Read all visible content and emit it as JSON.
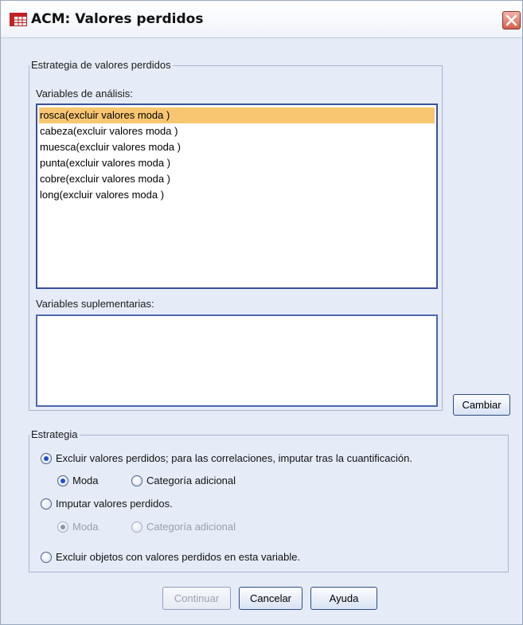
{
  "window": {
    "title": "ACM: Valores perdidos"
  },
  "strategy_group": {
    "legend": "Estrategia de valores perdidos",
    "analysis_label": "Variables de análisis:",
    "analysis_items": [
      "rosca(excluir valores moda )",
      "cabeza(excluir valores moda )",
      "muesca(excluir valores moda )",
      "punta(excluir valores moda )",
      "cobre(excluir valores moda )",
      "long(excluir valores moda )"
    ],
    "supplementary_label": "Variables suplementarias:",
    "change_button": "Cambiar"
  },
  "estrategia_group": {
    "legend": "Estrategia",
    "option_exclude": "Excluir valores perdidos; para las correlaciones, imputar tras la cuantificación.",
    "option_exclude_selected": true,
    "exclude_mode": "Moda",
    "exclude_additional": "Categoría adicional",
    "option_impute": "Imputar valores perdidos.",
    "impute_mode": "Moda",
    "impute_additional": "Categoría adicional",
    "option_exclude_objects": "Excluir objetos con valores perdidos en esta variable."
  },
  "buttons": {
    "continue": "Continuar",
    "cancel": "Cancelar",
    "help": "Ayuda"
  },
  "colors": {
    "window_bg": "#e5ecf8",
    "selection": "#f8c671",
    "close": "#d8604d"
  }
}
